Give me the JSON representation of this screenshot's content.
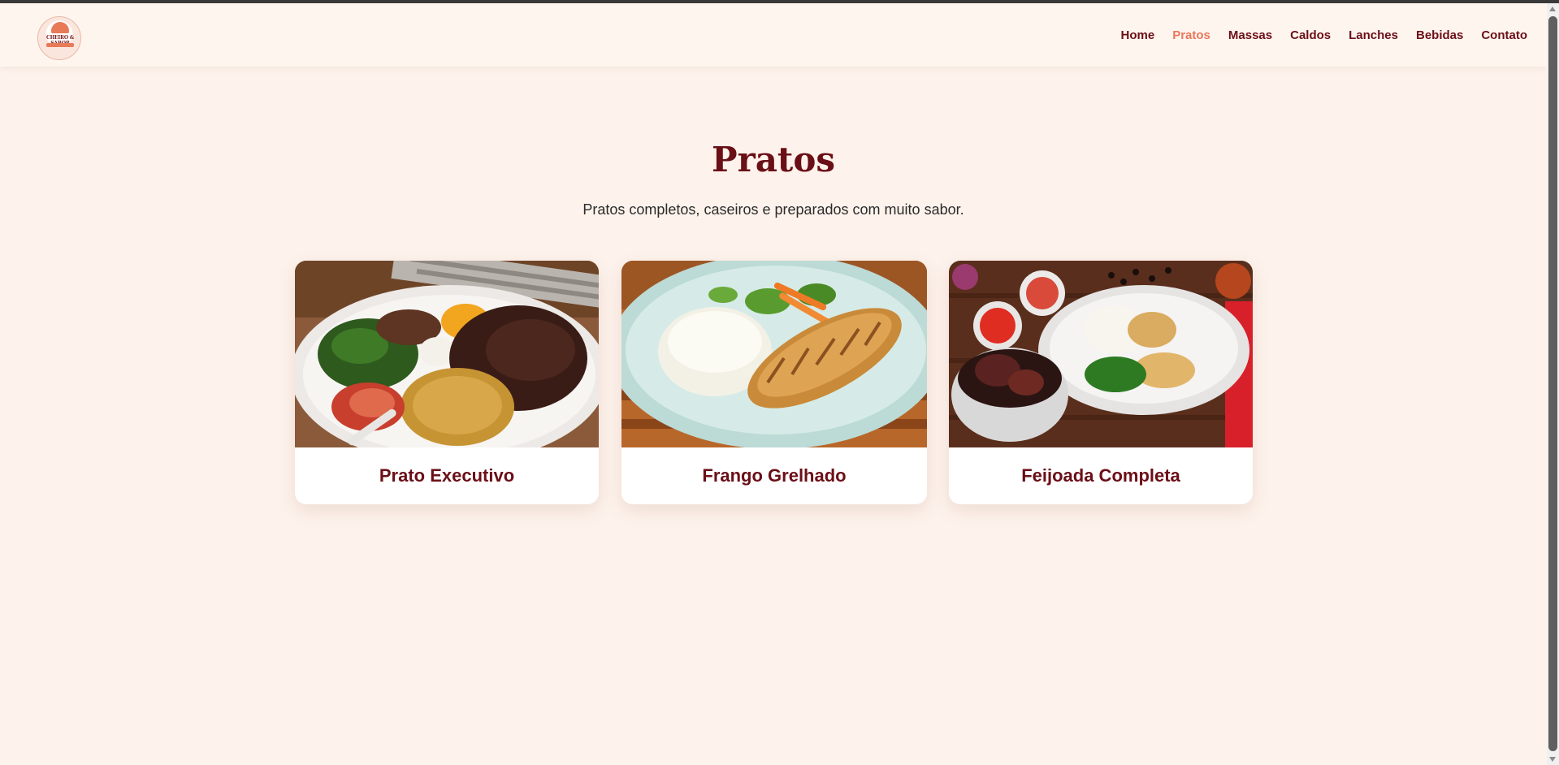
{
  "site": {
    "logo_text": "CHEIRO & SABOR"
  },
  "nav": {
    "items": [
      {
        "label": "Home"
      },
      {
        "label": "Pratos"
      },
      {
        "label": "Massas"
      },
      {
        "label": "Caldos"
      },
      {
        "label": "Lanches"
      },
      {
        "label": "Bebidas"
      },
      {
        "label": "Contato"
      }
    ],
    "active": "Pratos"
  },
  "main": {
    "title": "Pratos",
    "subtitle": "Pratos completos, caseiros e preparados com muito sabor.",
    "cards": [
      {
        "name": "Prato Executivo",
        "image": "prato-executivo-photo"
      },
      {
        "name": "Frango Grelhado",
        "image": "frango-grelhado-photo"
      },
      {
        "name": "Feijoada Completa",
        "image": "feijoada-completa-photo"
      }
    ]
  },
  "colors": {
    "background": "#fdf3ec",
    "brand": "#6b0f17",
    "accent": "#e8775c"
  }
}
